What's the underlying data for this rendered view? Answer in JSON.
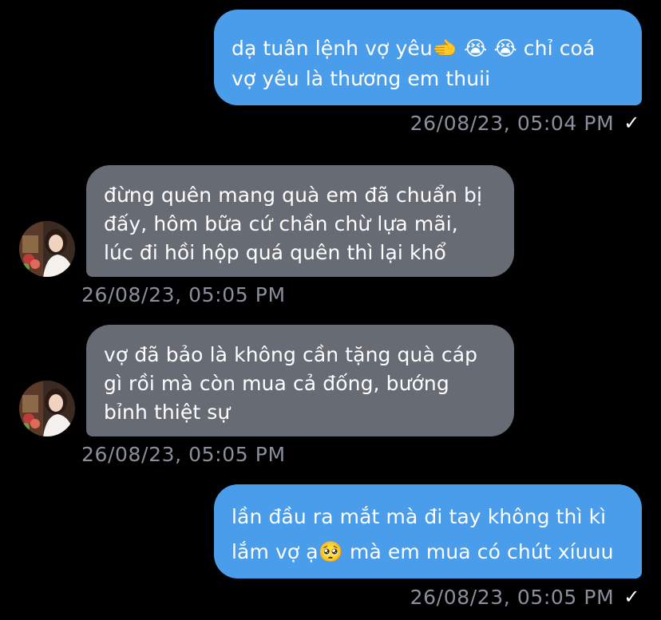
{
  "colors": {
    "background": "#000000",
    "outgoing_bubble": "#4a9dea",
    "incoming_bubble": "#666b74",
    "timestamp": "#8a8f9c"
  },
  "messages": [
    {
      "direction": "outgoing",
      "text": "dạ tuân lệnh vợ yêu🫲 😭 😭 chỉ coá\nvợ yêu là thương em thuii",
      "timestamp": "26/08/23, 05:04 PM",
      "status_icon": "checkmark-icon"
    },
    {
      "direction": "incoming",
      "text": "đừng quên mang quà em đã chuẩn bị\nđấy, hôm bữa cứ chần chừ lựa mãi,\nlúc đi hồi hộp quá quên thì lại khổ",
      "timestamp": "26/08/23, 05:05 PM",
      "avatar": "avatar-photo"
    },
    {
      "direction": "incoming",
      "text": "vợ đã bảo là không cần tặng quà cáp\ngì rồi mà còn mua cả đống, bướng\nbỉnh thiệt sự",
      "timestamp": "26/08/23, 05:05 PM",
      "avatar": "avatar-photo"
    },
    {
      "direction": "outgoing",
      "text": "lần đầu ra mắt mà đi tay không thì kì\nlắm vợ ạ🥺 mà em mua có chút xíuuu",
      "timestamp": "26/08/23, 05:05 PM",
      "status_icon": "checkmark-icon"
    }
  ],
  "check_glyph": "✓"
}
